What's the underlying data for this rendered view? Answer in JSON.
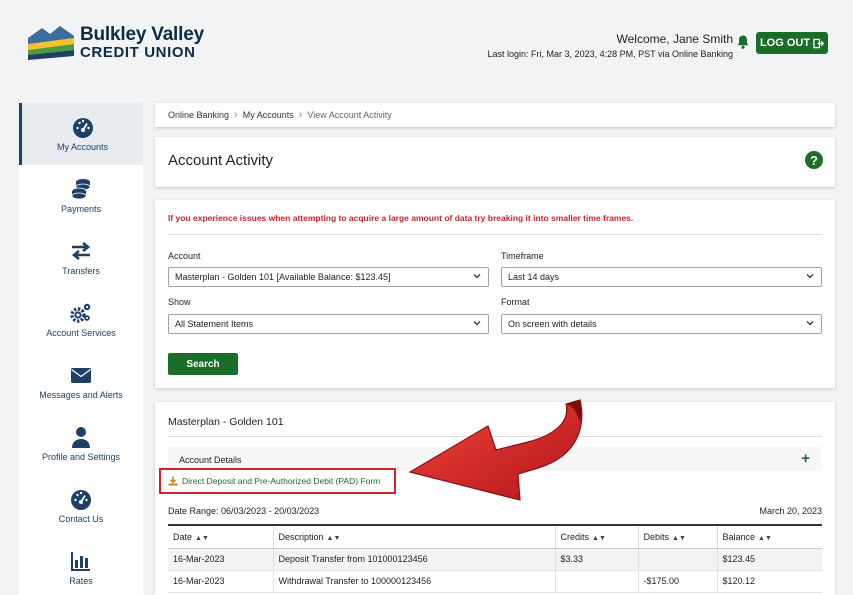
{
  "brand": {
    "line1": "Bulkley Valley",
    "line2": "CREDIT UNION"
  },
  "header": {
    "welcome": "Welcome, Jane Smith",
    "last_login": "Last login: Fri, Mar 3, 2023, 4:28 PM, PST via Online Banking",
    "logout_label": "LOG OUT"
  },
  "sidebar": {
    "items": [
      {
        "label": "My Accounts",
        "icon": "dashboard-icon"
      },
      {
        "label": "Payments",
        "icon": "coins-icon"
      },
      {
        "label": "Transfers",
        "icon": "transfer-arrows-icon"
      },
      {
        "label": "Account Services",
        "icon": "gears-icon"
      },
      {
        "label": "Messages and Alerts",
        "icon": "envelope-icon"
      },
      {
        "label": "Profile and Settings",
        "icon": "user-icon"
      },
      {
        "label": "Contact Us",
        "icon": "dashboard-icon"
      },
      {
        "label": "Rates",
        "icon": "bar-chart-icon"
      }
    ]
  },
  "breadcrumb": {
    "items": [
      "Online Banking",
      "My Accounts",
      "View Account Activity"
    ]
  },
  "page": {
    "title": "Account Activity"
  },
  "form": {
    "warning": "If you experience issues when attempting to acquire a large amount of data try breaking it into smaller time frames.",
    "account_label": "Account",
    "account_value": "Masterplan - Golden 101 [Available Balance: $123.45]",
    "timeframe_label": "Timeframe",
    "timeframe_value": "Last 14 days",
    "show_label": "Show",
    "show_value": "All Statement Items",
    "format_label": "Format",
    "format_value": "On screen with details",
    "search_label": "Search"
  },
  "activity": {
    "account_name": "Masterplan - Golden 101",
    "details_label": "Account Details",
    "expand_symbol": "+",
    "pad_link": "Direct Deposit and Pre-Authorized Debit (PAD) Form",
    "date_range": "Date Range: 06/03/2023 - 20/03/2023",
    "report_date": "March 20, 2023",
    "columns": [
      "Date",
      "Description",
      "Credits",
      "Debits",
      "Balance"
    ],
    "rows": [
      {
        "date": "16-Mar-2023",
        "description": "Deposit Transfer from 101000123456",
        "credits": "$3.33",
        "debits": "",
        "balance": "$123.45"
      },
      {
        "date": "16-Mar-2023",
        "description": "Withdrawal Transfer to 100000123456",
        "credits": "",
        "debits": "-$175.00",
        "balance": "$120.12"
      }
    ]
  },
  "colors": {
    "primary_green": "#1b6e2a",
    "navy": "#1e3f66",
    "warning_red": "#c0282d",
    "annotation_red": "#d42027"
  }
}
